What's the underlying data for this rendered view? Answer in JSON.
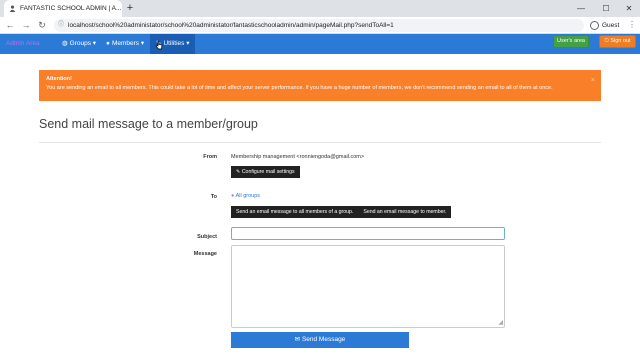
{
  "browser": {
    "tab_title": "FANTASTIC SCHOOL ADMIN | A...",
    "url": "localhost/school%20administator/school%20administator/fantasticschooladmin/admin/pageMail.php?sendToAll=1",
    "profile_label": "Guest",
    "icons": {
      "favicon": "user-icon",
      "tab_close": "close-icon",
      "new_tab": "plus-icon",
      "back": "arrow-left-icon",
      "forward": "arrow-right-icon",
      "reload": "reload-icon",
      "info": "info-icon",
      "menu": "kebab-icon"
    }
  },
  "navbar": {
    "brand": "Admin Area",
    "items": [
      {
        "label": "Groups",
        "icon": "globe-icon"
      },
      {
        "label": "Members",
        "icon": "user-icon"
      },
      {
        "label": "Utilities",
        "icon": "wrench-icon"
      }
    ],
    "users_area": "User's area",
    "sign_out": "Sign out",
    "colors": {
      "bar": "#2b7bd6",
      "active": "#1a5db5",
      "users_area": "#43a047",
      "sign_out": "#ef7d25"
    }
  },
  "alert": {
    "title": "Attention!",
    "message": "You are sending an email to all members. This could take a lot of time and affect your server performance. If you have a huge number of members, we don't recommend sending an email to all of them at once.",
    "close": "×",
    "color": "#f97f28"
  },
  "page": {
    "title": "Send mail message to a member/group",
    "from_label": "From",
    "from_value": "Membership management <ronniengoda@gmail.com>",
    "configure_button": "Configure mail settings",
    "to_label": "To",
    "to_link": "All groups",
    "send_all_members": "Send an email message to all members of a group.",
    "send_member": "Send an email message to member.",
    "subject_label": "Subject",
    "subject_value": "",
    "message_label": "Message",
    "message_value": "",
    "send_button": "Send Message"
  }
}
